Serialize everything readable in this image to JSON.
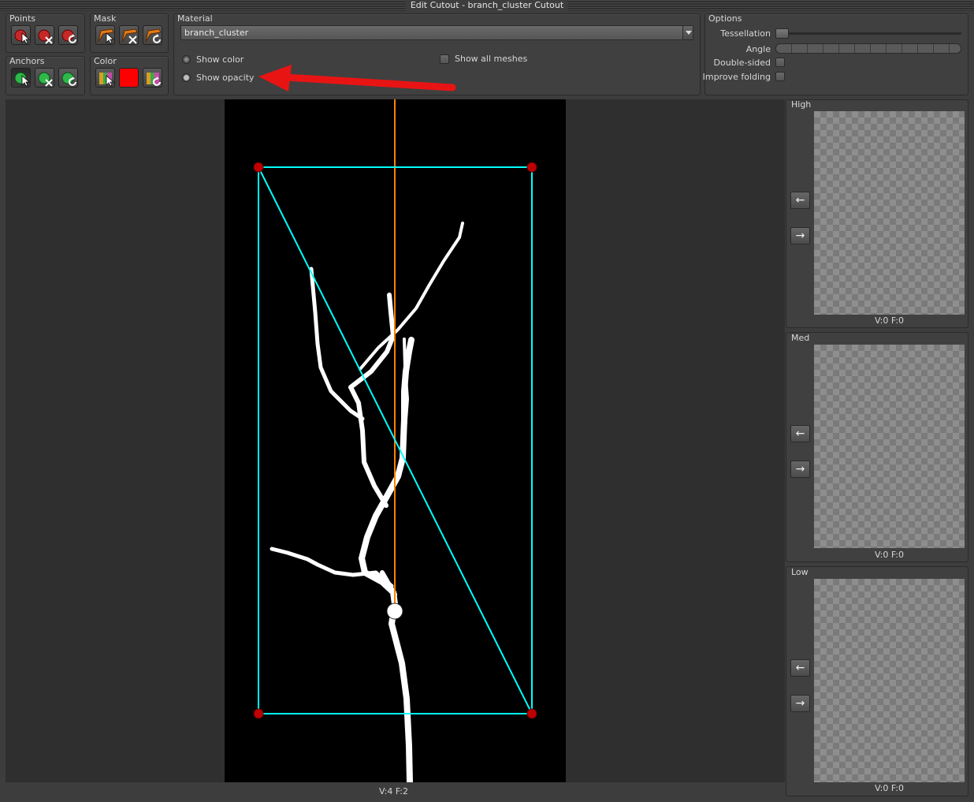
{
  "window": {
    "title": "Edit Cutout - branch_cluster Cutout"
  },
  "points": {
    "label": "Points"
  },
  "mask": {
    "label": "Mask"
  },
  "anchors": {
    "label": "Anchors"
  },
  "color": {
    "label": "Color",
    "swatch": "#ff0000"
  },
  "material": {
    "label": "Material",
    "value": "branch_cluster",
    "show_color": "Show color",
    "show_opacity": "Show opacity",
    "show_opacity_selected": true,
    "show_all_meshes": "Show all  meshes"
  },
  "options": {
    "label": "Options",
    "tessellation": "Tessellation",
    "angle": "Angle",
    "double_sided": "Double-sided",
    "improve_folding": "Improve folding"
  },
  "viewport": {
    "status": "V:4  F:2"
  },
  "lods": [
    {
      "label": "High",
      "status": "V:0  F:0"
    },
    {
      "label": "Med",
      "status": "V:0  F:0"
    },
    {
      "label": "Low",
      "status": "V:0  F:0"
    }
  ],
  "colors": {
    "cutout_outline": "#00ffff",
    "pivot_line": "#ff8000",
    "annotation_arrow": "#e81414",
    "point_marker": "#c00000"
  }
}
